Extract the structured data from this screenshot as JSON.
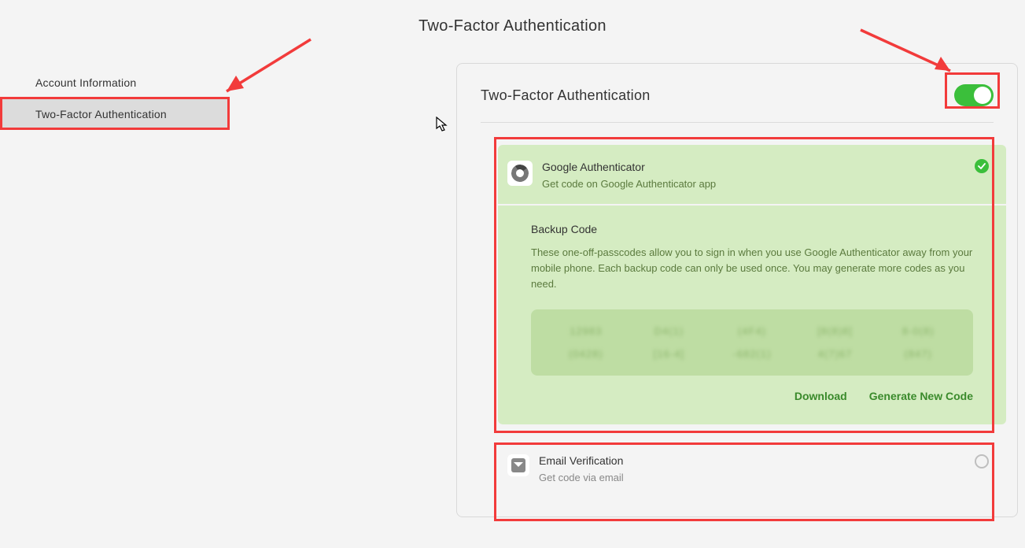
{
  "page_title": "Two-Factor Authentication",
  "sidebar": {
    "items": [
      {
        "label": "Account Information"
      },
      {
        "label": "Two-Factor Authentication"
      }
    ],
    "active_index": 1
  },
  "card": {
    "title": "Two-Factor Authentication",
    "toggle_on": true
  },
  "method_active": {
    "title": "Google Authenticator",
    "subtitle": "Get code on Google Authenticator app"
  },
  "backup": {
    "title": "Backup Code",
    "description": "These one-off-passcodes allow you to sign in when you use Google Authenticator away from your mobile phone. Each backup code can only be used once. You may generate more codes as you need.",
    "codes": [
      "12983",
      "D4(1)",
      "(4F4)",
      "[8(8)8]",
      "8-0(8)",
      "(0428)",
      "[16-4]",
      "-682(1)",
      "4(7)67",
      "(847)"
    ],
    "download_label": "Download",
    "generate_label": "Generate New Code"
  },
  "method_email": {
    "title": "Email Verification",
    "subtitle": "Get code via email"
  },
  "colors": {
    "accent_green": "#3bbf3b",
    "highlight_red": "#f23b3b",
    "panel_green": "#d5ecc2"
  }
}
